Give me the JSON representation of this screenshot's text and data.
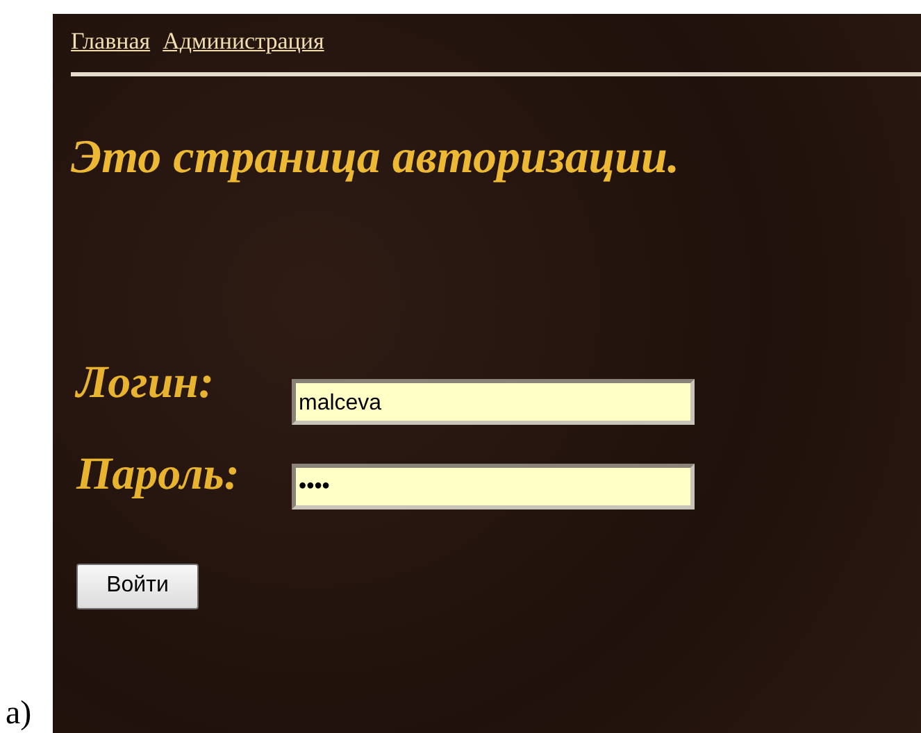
{
  "caption": "a)",
  "nav": [
    {
      "label": "Главная"
    },
    {
      "label": "Администрация"
    }
  ],
  "heading": "Это страница авторизации.",
  "fields": [
    {
      "label": "Логин:",
      "value": "malceva"
    },
    {
      "label": "Пароль:",
      "value": "••••"
    }
  ],
  "button": "Войти"
}
